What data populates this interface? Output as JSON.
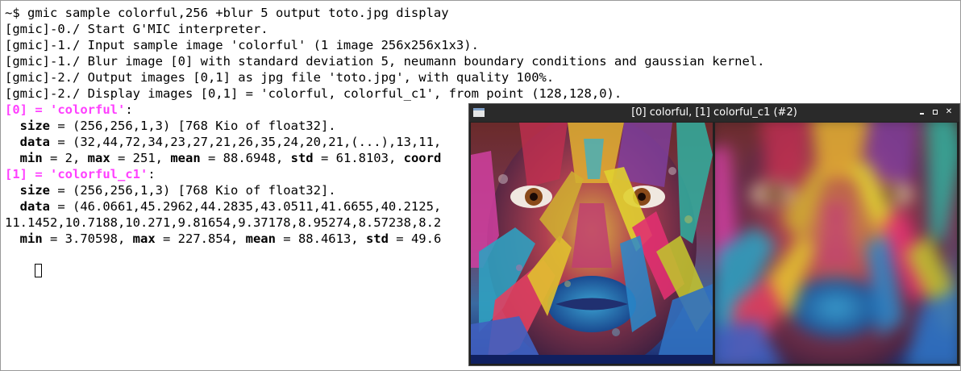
{
  "terminal": {
    "lines": [
      {
        "segments": [
          {
            "text": "~$ gmic sample colorful,256 +blur 5 output toto.jpg display",
            "style": "normal"
          }
        ]
      },
      {
        "segments": [
          {
            "text": "[gmic]-0./ Start G'MIC interpreter.",
            "style": "normal"
          }
        ]
      },
      {
        "segments": [
          {
            "text": "[gmic]-1./ Input sample image 'colorful' (1 image 256x256x1x3).",
            "style": "normal"
          }
        ]
      },
      {
        "segments": [
          {
            "text": "[gmic]-1./ Blur image [0] with standard deviation 5, neumann boundary conditions and gaussian kernel.",
            "style": "normal"
          }
        ]
      },
      {
        "segments": [
          {
            "text": "[gmic]-2./ Output images [0,1] as jpg file 'toto.jpg', with quality 100%.",
            "style": "normal"
          }
        ]
      },
      {
        "segments": [
          {
            "text": "[gmic]-2./ Display images [0,1] = 'colorful, colorful_c1', from point (128,128,0).",
            "style": "normal"
          }
        ]
      },
      {
        "segments": [
          {
            "text": "[0] = 'colorful'",
            "style": "magenta"
          },
          {
            "text": ":",
            "style": "normal"
          }
        ]
      },
      {
        "segments": [
          {
            "text": "  ",
            "style": "normal"
          },
          {
            "text": "size",
            "style": "bold"
          },
          {
            "text": " = (256,256,1,3) [768 Kio of float32].",
            "style": "normal"
          }
        ]
      },
      {
        "segments": [
          {
            "text": "  ",
            "style": "normal"
          },
          {
            "text": "data",
            "style": "bold"
          },
          {
            "text": " = (32,44,72,34,23,27,21,26,35,24,20,21,(...),13,11,",
            "style": "normal"
          }
        ]
      },
      {
        "segments": [
          {
            "text": "  ",
            "style": "normal"
          },
          {
            "text": "min",
            "style": "bold"
          },
          {
            "text": " = 2, ",
            "style": "normal"
          },
          {
            "text": "max",
            "style": "bold"
          },
          {
            "text": " = 251, ",
            "style": "normal"
          },
          {
            "text": "mean",
            "style": "bold"
          },
          {
            "text": " = 88.6948, ",
            "style": "normal"
          },
          {
            "text": "std",
            "style": "bold"
          },
          {
            "text": " = 61.8103, ",
            "style": "normal"
          },
          {
            "text": "coord",
            "style": "bold"
          }
        ]
      },
      {
        "segments": [
          {
            "text": "[1] = 'colorful_c1'",
            "style": "magenta"
          },
          {
            "text": ":",
            "style": "normal"
          }
        ]
      },
      {
        "segments": [
          {
            "text": "  ",
            "style": "normal"
          },
          {
            "text": "size",
            "style": "bold"
          },
          {
            "text": " = (256,256,1,3) [768 Kio of float32].",
            "style": "normal"
          }
        ]
      },
      {
        "segments": [
          {
            "text": "  ",
            "style": "normal"
          },
          {
            "text": "data",
            "style": "bold"
          },
          {
            "text": " = (46.0661,45.2962,44.2835,43.0511,41.6655,40.2125,",
            "style": "normal"
          }
        ]
      },
      {
        "segments": [
          {
            "text": "11.1452,10.7188,10.271,9.81654,9.37178,8.95274,8.57238,8.2",
            "style": "normal"
          }
        ]
      },
      {
        "segments": [
          {
            "text": "  ",
            "style": "normal"
          },
          {
            "text": "min",
            "style": "bold"
          },
          {
            "text": " = 3.70598, ",
            "style": "normal"
          },
          {
            "text": "max",
            "style": "bold"
          },
          {
            "text": " = 227.854, ",
            "style": "normal"
          },
          {
            "text": "mean",
            "style": "bold"
          },
          {
            "text": " = 88.4613, ",
            "style": "normal"
          },
          {
            "text": "std",
            "style": "bold"
          },
          {
            "text": " = 49.6",
            "style": "normal"
          }
        ]
      }
    ]
  },
  "display_window": {
    "title": "[0] colorful, [1] colorful_c1 (#2)",
    "icons": [
      "window-menu-icon",
      "minimize-icon",
      "maximize-icon",
      "close-icon"
    ],
    "images": [
      {
        "name": "colorful",
        "description_label": "colorful"
      },
      {
        "name": "colorful_c1",
        "description_label": "colorful_c1"
      }
    ]
  },
  "colors": {
    "terminal_bg": "#ffffff",
    "terminal_fg": "#000000",
    "image_label": "#ff40ff",
    "window_titlebar": "#2a2a2a",
    "window_title_fg": "#ffffff"
  }
}
